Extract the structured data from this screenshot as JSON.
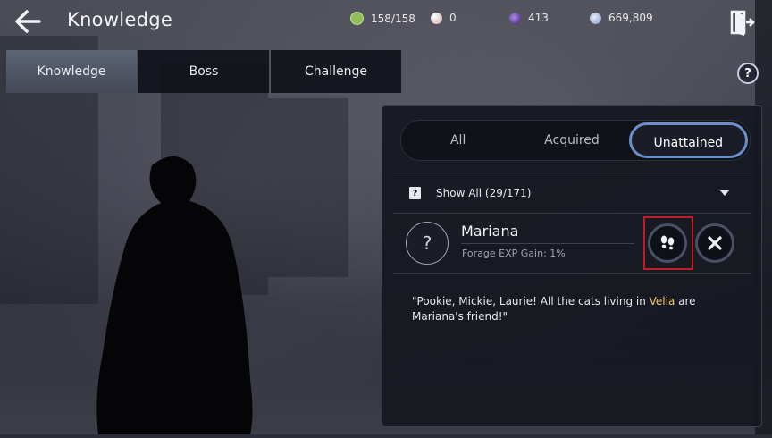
{
  "header": {
    "title": "Knowledge",
    "resources": [
      {
        "icon": "energy-icon",
        "value": "158/158",
        "color": "#8fbf5a"
      },
      {
        "icon": "pearl-icon",
        "value": "0",
        "color": "#d8c7c7"
      },
      {
        "icon": "black-gem-icon",
        "value": "413",
        "color": "#7a4fc7"
      },
      {
        "icon": "silver-coin-icon",
        "value": "669,809",
        "color": "#9fb3d6"
      }
    ]
  },
  "tabs": [
    {
      "label": "Knowledge",
      "active": true
    },
    {
      "label": "Boss",
      "active": false
    },
    {
      "label": "Challenge",
      "active": false
    }
  ],
  "panel": {
    "segments": [
      {
        "label": "All",
        "active": false
      },
      {
        "label": "Acquired",
        "active": false
      },
      {
        "label": "Unattained",
        "active": true
      }
    ],
    "filter_label": "Show All (29/171)",
    "filter_icon_glyph": "?",
    "entry": {
      "unknown_glyph": "?",
      "name": "Mariana",
      "effect": "Forage EXP Gain: 1%"
    },
    "quote": {
      "before": "\"Pookie, Mickie, Laurie! All the cats living in ",
      "highlight": "Velia",
      "after": " are Mariana's friend!\"",
      "highlight_color": "#f1c86b"
    }
  },
  "help_glyph": "?"
}
